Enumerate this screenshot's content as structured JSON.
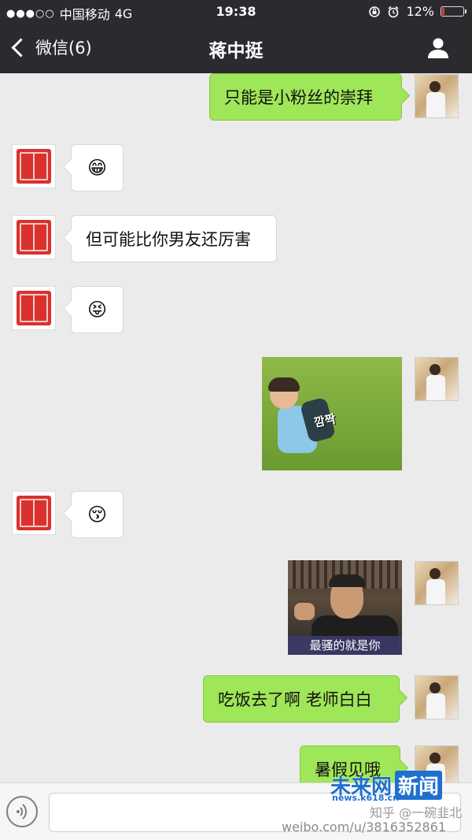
{
  "status_bar": {
    "signal": "●●●○○",
    "carrier": "中国移动",
    "network": "4G",
    "time": "19:38",
    "battery_percent": "12%",
    "battery_level": 0.12,
    "battery_color": "#e53935"
  },
  "nav": {
    "back_label": "微信(6)",
    "title": "蒋中挺",
    "profile_icon": "person-icon"
  },
  "messages": [
    {
      "side": "out",
      "type": "text",
      "text": "只能是小粉丝的崇拜"
    },
    {
      "side": "in",
      "type": "emoji",
      "text": "😁"
    },
    {
      "side": "in",
      "type": "text",
      "text": "但可能比你男友还厉害"
    },
    {
      "side": "in",
      "type": "emoji",
      "text": "😝"
    },
    {
      "side": "out",
      "type": "image",
      "image_text": "깜짝"
    },
    {
      "side": "in",
      "type": "emoji",
      "text": "😚"
    },
    {
      "side": "out",
      "type": "image",
      "caption": "最骚的就是你"
    },
    {
      "side": "out",
      "type": "text",
      "text": "吃饭去了啊 老师白白"
    },
    {
      "side": "out",
      "type": "text",
      "text": "暑假见哦"
    }
  ],
  "input_bar": {
    "voice_icon": "voice-icon",
    "input_value": ""
  },
  "watermarks": {
    "brand_cn": "未来网",
    "brand_news": "新闻",
    "brand_url": "news.k618.cn",
    "weibo_at": "知乎 @一碗韭北",
    "weibo_url": "weibo.com/u/3816352861"
  },
  "colors": {
    "header_bg": "#2b2b2f",
    "chat_bg": "#ebebeb",
    "outgoing_bubble": "#9fe658",
    "incoming_bubble": "#ffffff"
  }
}
